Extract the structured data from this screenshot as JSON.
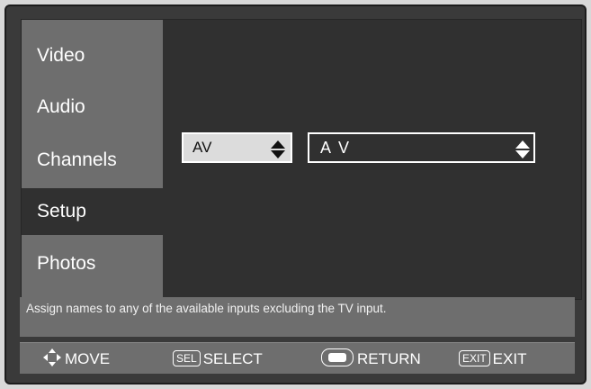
{
  "sidebar": {
    "items": [
      {
        "label": "Video"
      },
      {
        "label": "Audio"
      },
      {
        "label": "Channels"
      },
      {
        "label": "Setup"
      },
      {
        "label": "Photos"
      }
    ],
    "active_item": "Setup"
  },
  "input_select": {
    "value": "AV"
  },
  "input_name": {
    "value": "A V"
  },
  "help_text": "Assign names to any of the available inputs excluding the TV input.",
  "footer": {
    "move_label": "MOVE",
    "sel_key": "SEL",
    "select_label": "SELECT",
    "return_label": "RETURN",
    "exit_key": "EXIT",
    "exit_label": "EXIT"
  },
  "colors": {
    "sidebar": "#6e6e6e",
    "panel": "#303030",
    "active_item": "#303030",
    "text": "#ffffff"
  }
}
